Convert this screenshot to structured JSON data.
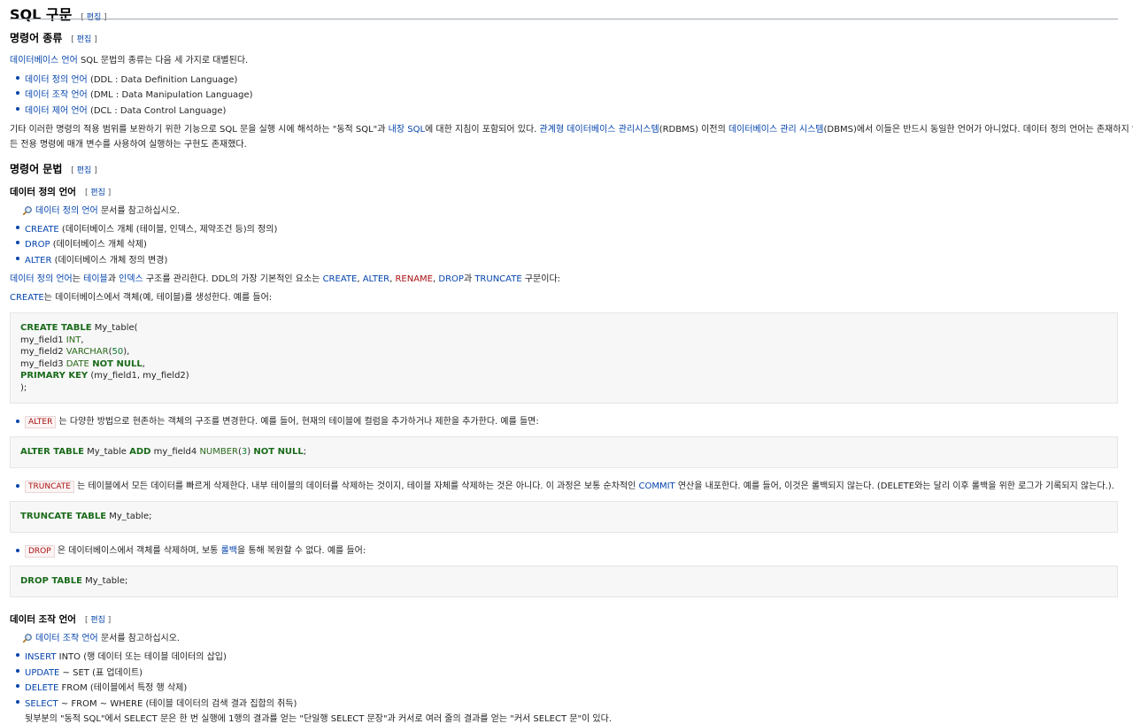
{
  "title": "SQL 구문",
  "edit_label": "편집",
  "sections": {
    "types": {
      "heading": "명령어 종류",
      "intro_link": "데이터베이스 언어",
      "intro_rest": " SQL 문법의 종류는 다음 세 가지로 대별된다.",
      "items": [
        {
          "link": "데이터 정의 언어",
          "rest": " (DDL : Data Definition Language)"
        },
        {
          "link": "데이터 조작 언어",
          "rest": " (DML : Data Manipulation Language)"
        },
        {
          "link": "데이터 제어 언어",
          "rest": " (DCL : Data Control Language)"
        }
      ],
      "para_1": "기타 이러한 명령의 적용 범위를 보완하기 위한 기능으로 SQL 문을 실행 시에 해석하는 \"동적 SQL\"과 ",
      "para_link_1": "내장 SQL",
      "para_2": "에 대한 지침이 포함되어 있다. ",
      "para_link_2": "관계형 데이터베이스 관리시스템",
      "para_3": "(RDBMS) 이전의 ",
      "para_link_3": "데이터베이스 관리 시스템",
      "para_4": "(DBMS)에서 이들은 반드시 동일한 언어가 아니었다. 데이터 정의 언어는 존재하지 않고, 모",
      "para_line2": "든 전용 명령에 매개 변수를 사용하여 실행하는 구현도 존재했다."
    },
    "syntax": {
      "heading": "명령어 문법",
      "ddl": {
        "heading": "데이터 정의 언어",
        "see_link": "데이터 정의 언어",
        "see_rest": " 문서를 참고하십시오.",
        "items": [
          {
            "link": "CREATE",
            "rest": " (데이터베이스 개체 (테이블, 인덱스, 제약조건 등)의 정의)"
          },
          {
            "link": "DROP",
            "rest": " (데이터베이스 개체 삭제)"
          },
          {
            "link": "ALTER",
            "rest": " (데이터베이스 개체 정의 변경)"
          }
        ],
        "para1": {
          "l1": "데이터 정의 언어",
          "t1": "는 ",
          "l2": "테이블",
          "t2": "과 ",
          "l3": "인덱스",
          "t3": " 구조를 관리한다. DDL의 가장 기본적인 요소는 ",
          "l4": "CREATE",
          "t4": ", ",
          "l5": "ALTER",
          "t5": ", ",
          "r6": "RENAME",
          "t6": ", ",
          "l7": "DROP",
          "t7": "과 ",
          "l8": "TRUNCATE",
          "t8": " 구문이다:"
        },
        "para2": {
          "l1": "CREATE",
          "t1": "는 데이터베이스에서 객체(예, 테이블)를 생성한다. 예를 들어:"
        },
        "create_code": {
          "l1_kw": "CREATE TABLE",
          "l1_rest": " My_table(",
          "l2_a": " my_field1 ",
          "l2_ty": "INT",
          "l2_b": ",",
          "l3_a": " my_field2 ",
          "l3_ty": "VARCHAR",
          "l3_b": "(",
          "l3_n": "50",
          "l3_c": "),",
          "l4_a": " my_field3 ",
          "l4_ty": "DATE",
          "l4_kw": " NOT NULL",
          "l4_b": ",",
          "l5_kw": " PRIMARY KEY",
          "l5_rest": " (my_field1, my_field2)",
          "l6": ");"
        },
        "alter_item": {
          "tag": "ALTER",
          "text": " 는 다양한 방법으로 현존하는 객체의 구조를 변경한다. 예를 들어, 현재의 테이블에 컬럼을 추가하거나 제한을 추가한다. 예를 들면:"
        },
        "alter_code": {
          "kw1": "ALTER TABLE",
          "a": " My_table ",
          "kw2": "ADD",
          "b": " my_field4 ",
          "ty": "NUMBER",
          "c": "(",
          "n": "3",
          "d": ") ",
          "kw3": "NOT NULL",
          "e": ";"
        },
        "truncate_item": {
          "tag": "TRUNCATE",
          "text": " 는 테이블에서 모든 데이터를 빠르게 삭제한다. 내부 테이블의 데이터를 삭제하는 것이지, 테이블 자체를 삭제하는 것은 아니다. 이 과정은 보통 순차적인 ",
          "link": "COMMIT",
          "text2": " 연산을 내포한다. 예를 들어, 이것은 롤백되지 않는다. (DELETE와는 달리 이후 롤백을 위한 로그가 기록되지 않는다.)."
        },
        "truncate_code": {
          "kw": "TRUNCATE TABLE",
          "rest": " My_table;"
        },
        "drop_item": {
          "tag": "DROP",
          "text": " 은 데이터베이스에서 객체를 삭제하며, 보통 ",
          "link": "롤백",
          "text2": "을 통해 복원할 수 없다. 예를 들어:"
        },
        "drop_code": {
          "kw": "DROP TABLE",
          "rest": " My_table;"
        }
      },
      "dml": {
        "heading": "데이터 조작 언어",
        "see_link": "데이터 조작 언어",
        "see_rest": " 문서를 참고하십시오.",
        "items": [
          {
            "link": "INSERT",
            "rest": " INTO (행 데이터 또는 테이블 데이터의 삽입)"
          },
          {
            "link": "UPDATE",
            "rest": " ~ SET (표 업데이트)"
          },
          {
            "link": "DELETE",
            "rest": " FROM (테이블에서 특정 행 삭제)"
          },
          {
            "link": "SELECT",
            "rest": " ~ FROM ~ WHERE (테이블 데이터의 검색 결과 집합의 취득)"
          }
        ],
        "note": "뒷부분의 \"동적 SQL\"에서 SELECT 문은 한 번 실행에 1행의 결과를 얻는 \"단일행 SELECT 문장\"과 커서로 여러 줄의 결과를 얻는 \"커서 SELECT 문\"이 있다."
      }
    }
  }
}
